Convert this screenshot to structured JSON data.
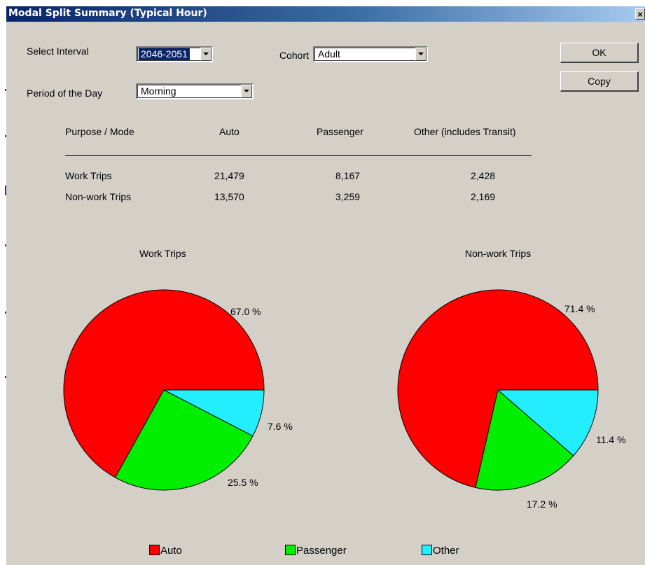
{
  "window": {
    "title": "Modal Split Summary (Typical Hour)",
    "close_glyph": "×"
  },
  "controls": {
    "interval_label": "Select Interval",
    "interval_value": "2046-2051",
    "cohort_label": "Cohort",
    "cohort_value": "Adult",
    "period_label": "Period of the Day",
    "period_value": "Morning"
  },
  "buttons": {
    "ok": "OK",
    "copy": "Copy"
  },
  "table": {
    "headers": [
      "Purpose / Mode",
      "Auto",
      "Passenger",
      "Other (includes Transit)"
    ],
    "rows": [
      [
        "Work Trips",
        "21,479",
        "8,167",
        "2,428"
      ],
      [
        "Non-work Trips",
        "13,570",
        "3,259",
        "2,169"
      ]
    ]
  },
  "chart_data": [
    {
      "type": "pie",
      "title": "Work Trips",
      "categories": [
        "Auto",
        "Passenger",
        "Other"
      ],
      "values": [
        67.0,
        25.5,
        7.6
      ],
      "labels": [
        "67.0 %",
        "25.5 %",
        "7.6 %"
      ],
      "colors": [
        "#ff0000",
        "#00ee00",
        "#22eeff"
      ]
    },
    {
      "type": "pie",
      "title": "Non-work Trips",
      "categories": [
        "Auto",
        "Passenger",
        "Other"
      ],
      "values": [
        71.4,
        17.2,
        11.4
      ],
      "labels": [
        "71.4 %",
        "17.2 %",
        "11.4 %"
      ],
      "colors": [
        "#ff0000",
        "#00ee00",
        "#22eeff"
      ]
    }
  ],
  "legend": [
    {
      "label": "Auto",
      "color": "#ff0000"
    },
    {
      "label": "Passenger",
      "color": "#00ee00"
    },
    {
      "label": "Other",
      "color": "#22eeff"
    }
  ]
}
